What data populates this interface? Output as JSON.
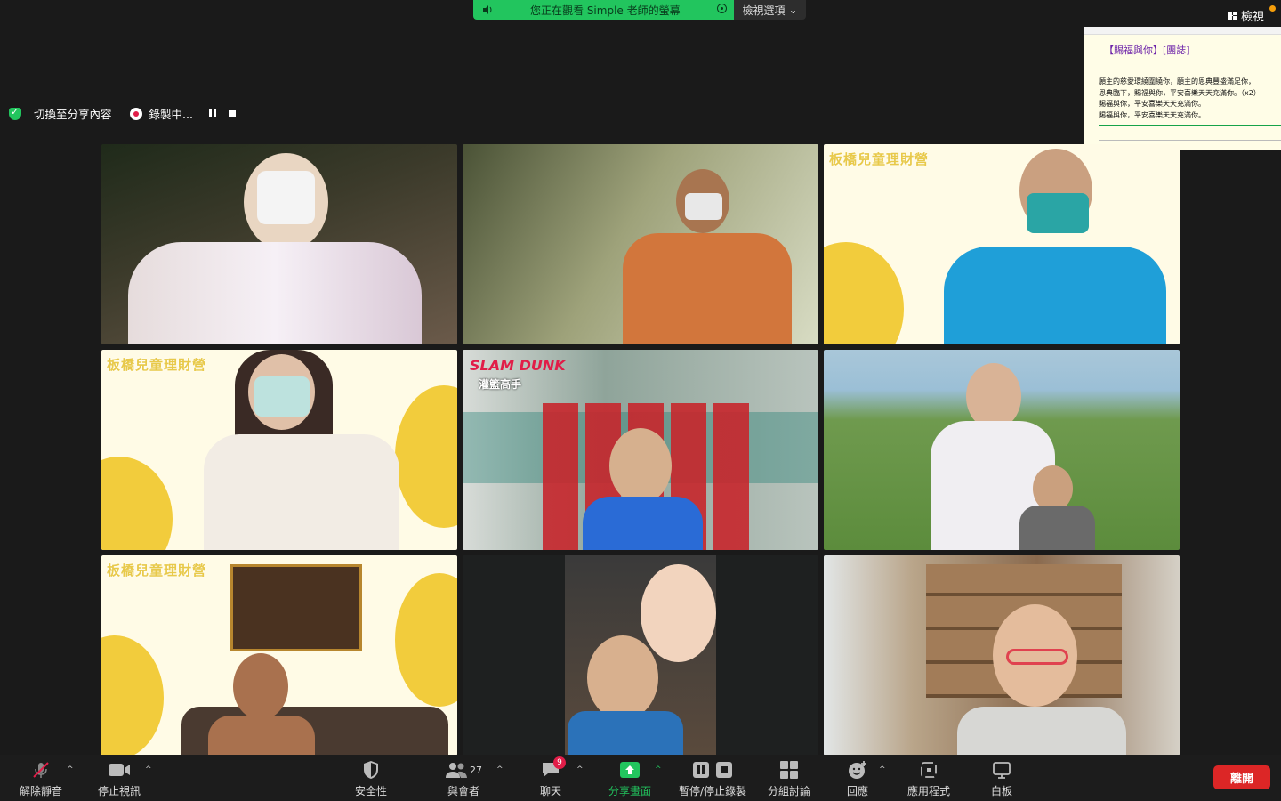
{
  "top": {
    "viewing_text": "您正在觀看 Simple 老師的螢幕",
    "view_options": "檢視選項",
    "view_button": "檢視"
  },
  "status": {
    "switch_share": "切換至分享內容",
    "recording": "錄製中..."
  },
  "tiles": {
    "banner": "板橋兒童理財營",
    "slamdunk": "SLAM DUNK",
    "slamdunk_sub": "灌籃高手"
  },
  "preview": {
    "title": "【賜福與你】[團誌]",
    "lines": [
      "願主的慈愛環繞圍繞你，願主的恩典豐盛滿足你，",
      "恩典臨下，賜福與你，平安喜樂天天充滿你。（x2）",
      "賜福與你，平安喜樂天天充滿你。",
      "賜福與你，平安喜樂天天充滿你。"
    ],
    "repeat_tag": "(x2)"
  },
  "toolbar": {
    "unmute": "解除靜音",
    "stop_video": "停止視訊",
    "security": "安全性",
    "participants": "與會者",
    "participant_count": "27",
    "chat": "聊天",
    "chat_badge": "9",
    "share_screen": "分享畫面",
    "pause_stop_record": "暫停/停止錄製",
    "breakout": "分組討論",
    "reactions": "回應",
    "apps": "應用程式",
    "whiteboard": "白板",
    "leave": "離開"
  },
  "colors": {
    "share_green": "#22c55e",
    "leave_red": "#dc2626",
    "banner_yellow": "#f2cc3c"
  }
}
